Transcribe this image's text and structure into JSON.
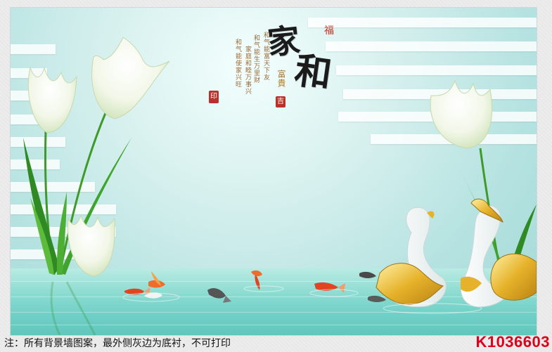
{
  "mural": {
    "title_chars": [
      "家",
      "和"
    ],
    "small_seal": "福",
    "fugui": "富貴",
    "poem_lines": [
      "和气能使家兴旺",
      "家庭和睦万事兴",
      "和气能生万里财",
      "和气能富天下友"
    ],
    "seal_square": "印",
    "seal_small": "吉"
  },
  "footer": {
    "note": "注：所有背景墙图案，最外侧灰边为底衬，不可打印",
    "code": "K1036603"
  },
  "colors": {
    "water": "#6fd0c6",
    "sky": "#d6f0ee",
    "code_red": "#e0001b",
    "gold": "#e6b22a"
  }
}
